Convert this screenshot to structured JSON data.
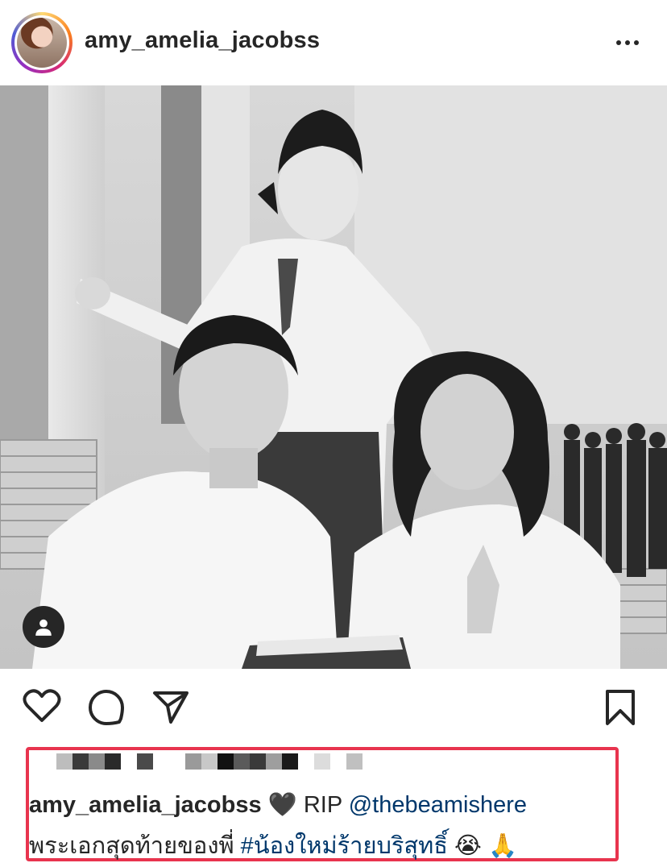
{
  "header": {
    "username": "amy_amelia_jacobss",
    "more_icon": "more-horizontal-icon"
  },
  "post": {
    "image_alt": "black and white photo of three students in white school uniforms",
    "tag_icon": "person-icon"
  },
  "actions": {
    "like_icon": "heart-outline-icon",
    "comment_icon": "comment-icon",
    "share_icon": "send-icon",
    "save_icon": "bookmark-icon"
  },
  "caption": {
    "username": "amy_amelia_jacobss",
    "heart": "🖤",
    "text_rip": "RIP",
    "mention": "@thebeamishere",
    "line2_text": "พระเอกสุดท้ายของพี่",
    "hashtag": "#น้องใหม่ร้ายบริสุทธิ์",
    "emojis": "😭 🙏"
  },
  "highlight_color": "#e8344e",
  "link_color": "#00376b"
}
